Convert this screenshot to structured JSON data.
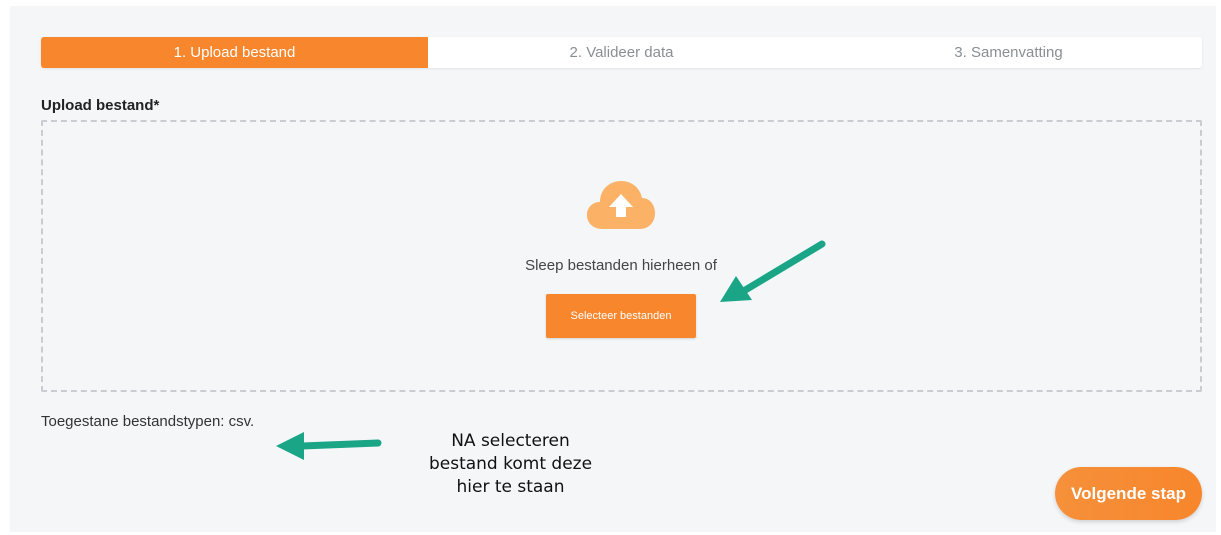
{
  "stepper": {
    "steps": [
      {
        "label": "1. Upload bestand",
        "active": true
      },
      {
        "label": "2. Valideer data",
        "active": false
      },
      {
        "label": "3. Samenvatting",
        "active": false
      }
    ]
  },
  "upload": {
    "label": "Upload bestand*",
    "drop_text": "Sleep bestanden hierheen of",
    "select_button": "Selecteer bestanden",
    "icon": "cloud-upload-icon"
  },
  "allowed_types": "Toegestane bestandstypen: csv.",
  "annotation": {
    "lines": [
      "NA selecteren",
      "bestand komt deze",
      "hier te staan"
    ],
    "arrow_color": "#1aa586"
  },
  "next_button": "Volgende stap",
  "colors": {
    "accent": "#f7862c",
    "accent_light": "#fbb267"
  }
}
